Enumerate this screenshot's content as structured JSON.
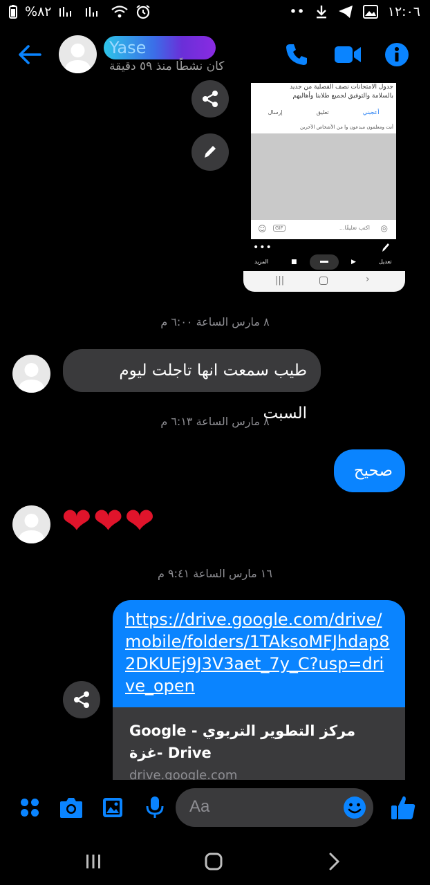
{
  "status_bar": {
    "time": "١٢:٠٦",
    "battery": "%٨٢",
    "more": "••"
  },
  "header": {
    "contact_name": "Yase",
    "active_status": "كان نشطًا منذ ٥٩ دقيقة",
    "icons": [
      "back-arrow-icon",
      "phone-icon",
      "video-icon",
      "info-icon"
    ],
    "accent_color": "#0a84ff"
  },
  "shared_image": {
    "top_text_1": "جدول الامتحانات نصف الفصلية من جديد",
    "top_text_2": "بالسلامة والتوفيق لجميع طلابنا وأهاليهم",
    "like_label": "أعجبني",
    "comment_label": "تعليق",
    "send_label": "إرسال",
    "note": "أنت ومعلمون مبدعون وا من الأشخاص الآخرين",
    "comment_placeholder": "اكتب تعليقًا...",
    "gif_label": "GIF",
    "more_label": "المزيد",
    "edit_label": "تعديل"
  },
  "messages": {
    "ts1": "٨ مارس الساعة ٦:٠٠ م",
    "msg1": "طيب سمعت انها تاجلت ليوم السبت",
    "ts2": "٨ مارس الساعة ٦:١٣ م",
    "msg2": "صحيح",
    "msg3": "❤❤❤",
    "ts3": "١٦ مارس الساعة ٩:٤١ م",
    "link_url": "https://drive.google.com/drive/mobile/folders/1TAksoMFJhdap82DKUEj9J3V3aet_7y_C?usp=drive_open",
    "link_title": "Google - مركز التطوير التربوي -غزة Drive",
    "link_domain": "drive.google.com"
  },
  "composer": {
    "placeholder": "Aa"
  }
}
